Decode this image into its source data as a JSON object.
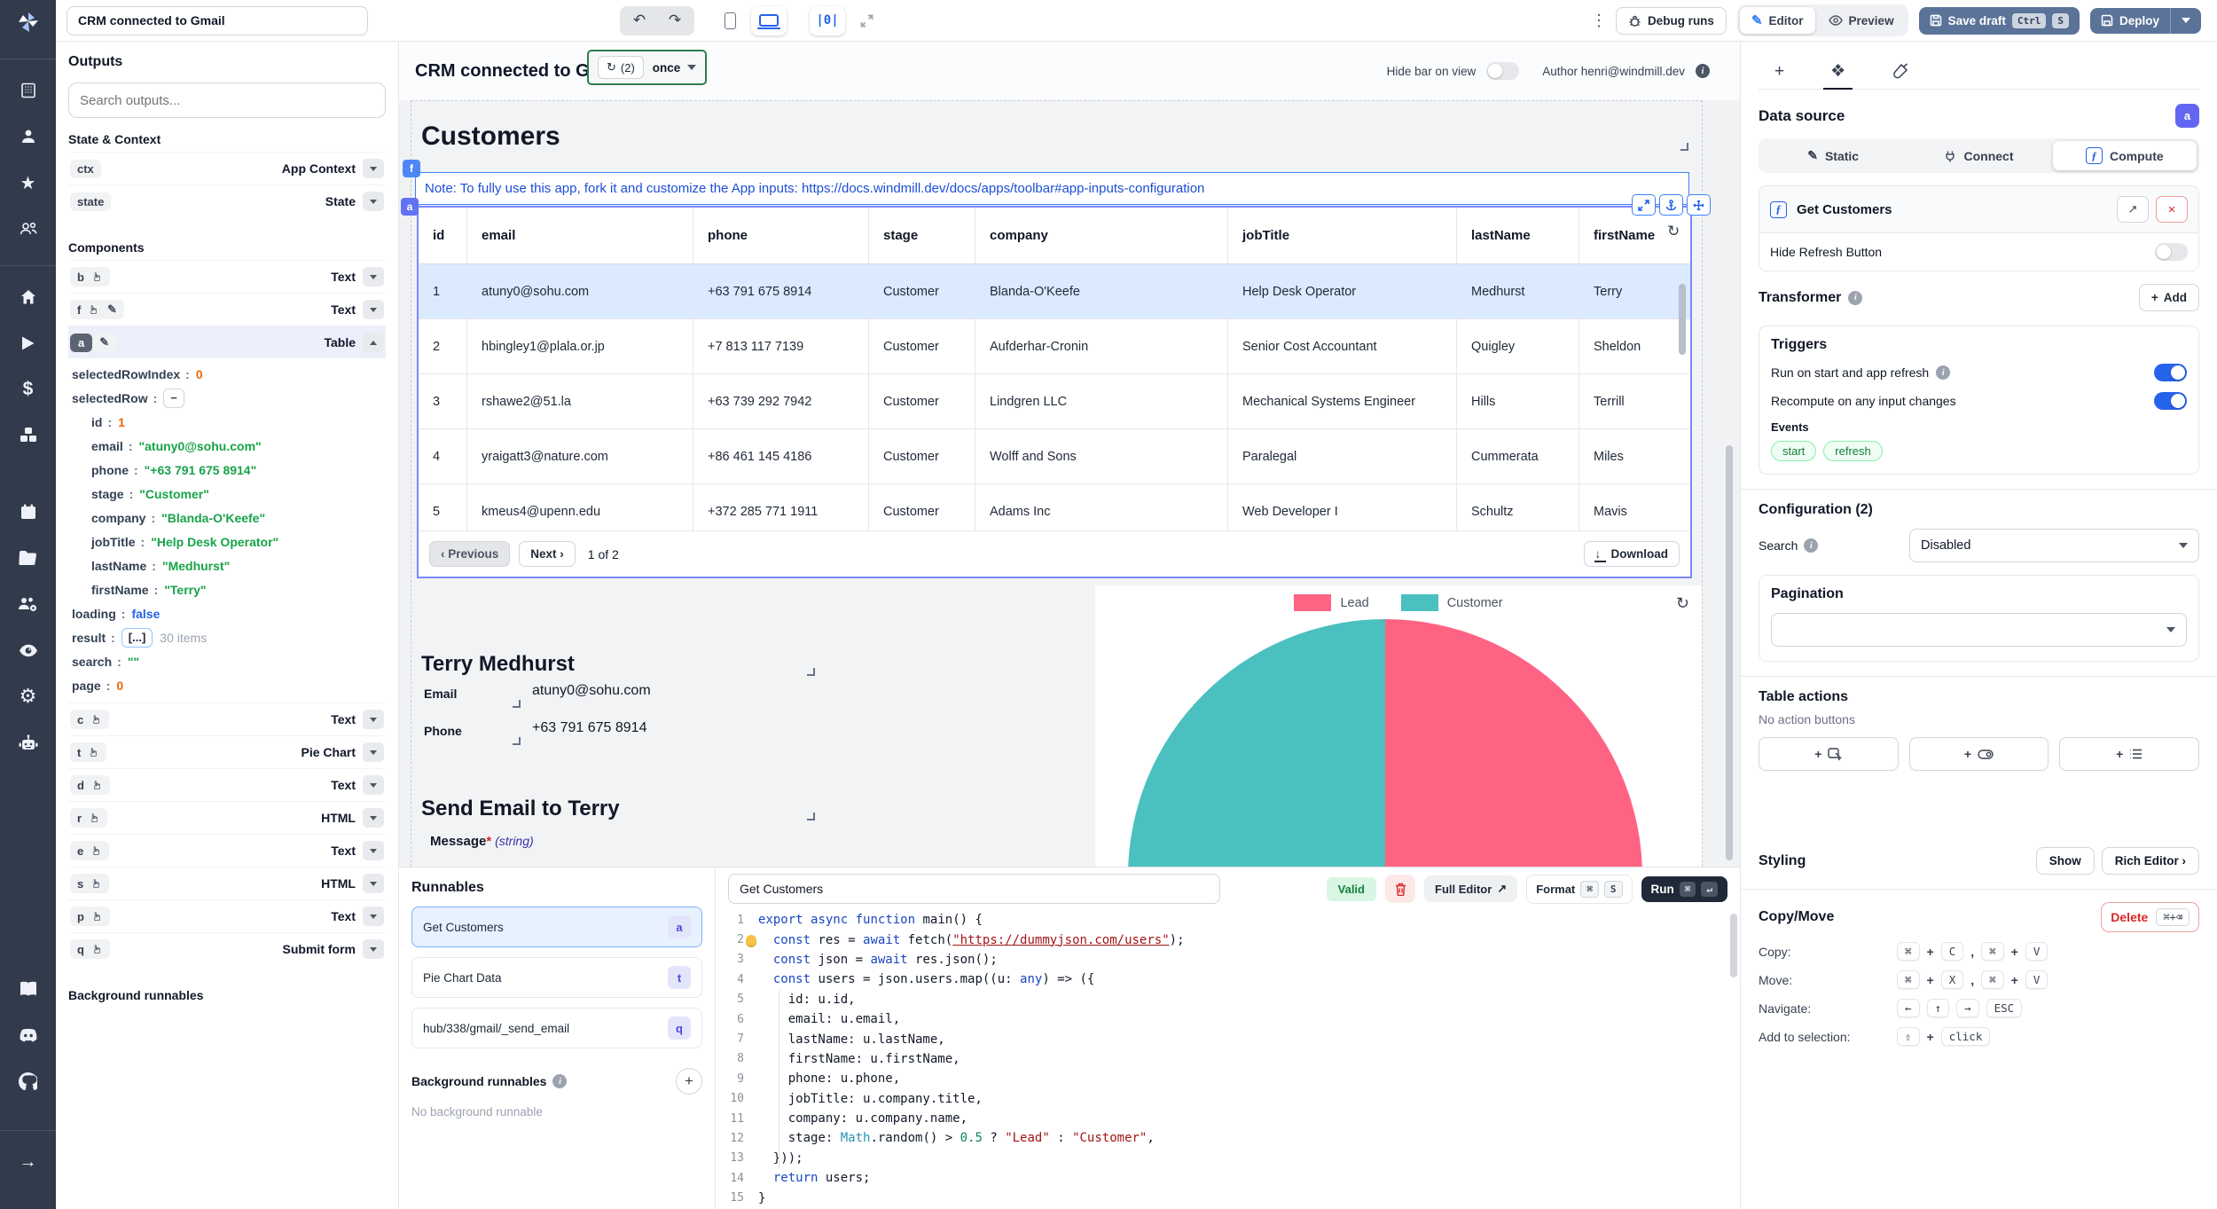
{
  "topbar": {
    "app_title_value": "CRM connected to Gmail",
    "debug_runs_label": "Debug runs",
    "editor_label": "Editor",
    "preview_label": "Preview",
    "save_draft_label": "Save draft",
    "save_kbd": [
      "Ctrl",
      "S"
    ],
    "deploy_label": "Deploy",
    "center_align_label": "|0|"
  },
  "sidebar": {
    "outputs_title": "Outputs",
    "search_placeholder": "Search outputs...",
    "state_context_title": "State & Context",
    "state_rows": [
      {
        "id": "ctx",
        "type": "App Context"
      },
      {
        "id": "state",
        "type": "State"
      }
    ],
    "components_title": "Components",
    "component_rows": [
      {
        "id": "b",
        "type": "Text",
        "icons": [
          "hand"
        ]
      },
      {
        "id": "f",
        "type": "Text",
        "icons": [
          "hand",
          "pencil"
        ]
      },
      {
        "id": "a",
        "type": "Table",
        "icons": [
          "pencil"
        ],
        "selected": true,
        "expanded": true
      },
      {
        "id": "c",
        "type": "Text",
        "icons": [
          "hand"
        ]
      },
      {
        "id": "t",
        "type": "Pie Chart",
        "icons": [
          "hand"
        ]
      },
      {
        "id": "d",
        "type": "Text",
        "icons": [
          "hand"
        ]
      },
      {
        "id": "r",
        "type": "HTML",
        "icons": [
          "hand"
        ]
      },
      {
        "id": "e",
        "type": "Text",
        "icons": [
          "hand"
        ]
      },
      {
        "id": "s",
        "type": "HTML",
        "icons": [
          "hand"
        ]
      },
      {
        "id": "p",
        "type": "Text",
        "icons": [
          "hand"
        ]
      },
      {
        "id": "q",
        "type": "Submit form",
        "icons": [
          "hand"
        ]
      }
    ],
    "table_output": [
      {
        "key": "selectedRowIndex",
        "value": "0",
        "vtype": "num",
        "indent": 0
      },
      {
        "key": "selectedRow",
        "value": "−",
        "vtype": "box",
        "indent": 0
      },
      {
        "key": "id",
        "value": "1",
        "vtype": "num",
        "indent": 1
      },
      {
        "key": "email",
        "value": "\"atuny0@sohu.com\"",
        "vtype": "str",
        "indent": 1
      },
      {
        "key": "phone",
        "value": "\"+63 791 675 8914\"",
        "vtype": "str",
        "indent": 1
      },
      {
        "key": "stage",
        "value": "\"Customer\"",
        "vtype": "str",
        "indent": 1
      },
      {
        "key": "company",
        "value": "\"Blanda-O'Keefe\"",
        "vtype": "str",
        "indent": 1
      },
      {
        "key": "jobTitle",
        "value": "\"Help Desk Operator\"",
        "vtype": "str",
        "indent": 1
      },
      {
        "key": "lastName",
        "value": "\"Medhurst\"",
        "vtype": "str",
        "indent": 1
      },
      {
        "key": "firstName",
        "value": "\"Terry\"",
        "vtype": "str",
        "indent": 1
      },
      {
        "key": "loading",
        "value": "false",
        "vtype": "bool",
        "indent": 0
      },
      {
        "key": "result",
        "value": "[...]",
        "vtype": "boxblue",
        "suffix": "30 items",
        "indent": 0
      },
      {
        "key": "search",
        "value": "\"\"",
        "vtype": "str",
        "indent": 0
      },
      {
        "key": "page",
        "value": "0",
        "vtype": "num",
        "indent": 0
      }
    ],
    "background_runnables_title": "Background runnables"
  },
  "canvas": {
    "title": "CRM connected to Gmail",
    "refresh_count": "(2)",
    "refresh_mode": "once",
    "hide_bar_label": "Hide bar on view",
    "author_label": "Author henri@windmill.dev",
    "page_title": "Customers",
    "note_badge": "f",
    "table_badge": "a",
    "note_text": "Note: To fully use this app, fork it and customize the App inputs: https://docs.windmill.dev/docs/apps/toolbar#app-inputs-configuration",
    "table": {
      "headers": [
        "id",
        "email",
        "phone",
        "stage",
        "company",
        "jobTitle",
        "lastName",
        "firstName"
      ],
      "rows": [
        [
          "1",
          "atuny0@sohu.com",
          "+63 791 675 8914",
          "Customer",
          "Blanda-O'Keefe",
          "Help Desk Operator",
          "Medhurst",
          "Terry"
        ],
        [
          "2",
          "hbingley1@plala.or.jp",
          "+7 813 117 7139",
          "Customer",
          "Aufderhar-Cronin",
          "Senior Cost Accountant",
          "Quigley",
          "Sheldon"
        ],
        [
          "3",
          "rshawe2@51.la",
          "+63 739 292 7942",
          "Customer",
          "Lindgren LLC",
          "Mechanical Systems Engineer",
          "Hills",
          "Terrill"
        ],
        [
          "4",
          "yraigatt3@nature.com",
          "+86 461 145 4186",
          "Customer",
          "Wolff and Sons",
          "Paralegal",
          "Cummerata",
          "Miles"
        ],
        [
          "5",
          "kmeus4@upenn.edu",
          "+372 285 771 1911",
          "Customer",
          "Adams Inc",
          "Web Developer I",
          "Schultz",
          "Mavis"
        ]
      ],
      "selected_row_index": 0,
      "prev_label": "Previous",
      "next_label": "Next",
      "page_indicator": "1 of 2",
      "download_label": "Download"
    },
    "contact": {
      "name": "Terry Medhurst",
      "email_label": "Email",
      "email": "atuny0@sohu.com",
      "phone_label": "Phone",
      "phone": "+63 791 675 8914"
    },
    "send_email_title": "Send Email to Terry",
    "message_label": "Message",
    "message_required": "*",
    "message_type": "(string)"
  },
  "chart_data": {
    "type": "pie",
    "labels": [
      "Lead",
      "Customer"
    ],
    "values": [
      15,
      15
    ],
    "colors": [
      "#FF6384",
      "#4BC0C0"
    ],
    "title": "",
    "legend_position": "top"
  },
  "runnables": {
    "title": "Runnables",
    "items": [
      {
        "label": "Get Customers",
        "badge": "a",
        "selected": true
      },
      {
        "label": "Pie Chart Data",
        "badge": "t",
        "selected": false
      },
      {
        "label": "hub/338/gmail/_send_email",
        "badge": "q",
        "selected": false
      }
    ],
    "background_title": "Background runnables",
    "background_empty": "No background runnable"
  },
  "editor": {
    "name_value": "Get Customers",
    "valid_label": "Valid",
    "full_editor_label": "Full Editor",
    "full_editor_icon": "↗",
    "format_label": "Format",
    "format_kbd": [
      "⌘",
      "S"
    ],
    "run_label": "Run",
    "run_kbd": [
      "⌘",
      "↵"
    ],
    "code": [
      {
        "n": "1",
        "seg": [
          [
            "k",
            "export"
          ],
          [
            "p",
            " "
          ],
          [
            "k",
            "async"
          ],
          [
            "p",
            " "
          ],
          [
            "k",
            "function"
          ],
          [
            "p",
            " main() {"
          ]
        ]
      },
      {
        "n": "2",
        "bulb": true,
        "seg": [
          [
            "p",
            "  "
          ],
          [
            "k",
            "const"
          ],
          [
            "p",
            " res = "
          ],
          [
            "k",
            "await"
          ],
          [
            "p",
            " fetch("
          ],
          [
            "sl",
            "\"https://dummyjson.com/users\""
          ],
          [
            "p",
            ");"
          ]
        ]
      },
      {
        "n": "3",
        "seg": [
          [
            "p",
            "  "
          ],
          [
            "k",
            "const"
          ],
          [
            "p",
            " json = "
          ],
          [
            "k",
            "await"
          ],
          [
            "p",
            " res.json();"
          ]
        ]
      },
      {
        "n": "4",
        "seg": [
          [
            "p",
            "  "
          ],
          [
            "k",
            "const"
          ],
          [
            "p",
            " users = json.users.map((u: "
          ],
          [
            "k",
            "any"
          ],
          [
            "p",
            ") => ({"
          ]
        ]
      },
      {
        "n": "5",
        "seg": [
          [
            "p",
            "    id: u.id,"
          ]
        ]
      },
      {
        "n": "6",
        "seg": [
          [
            "p",
            "    email: u.email,"
          ]
        ]
      },
      {
        "n": "7",
        "seg": [
          [
            "p",
            "    lastName: u.lastName,"
          ]
        ]
      },
      {
        "n": "8",
        "seg": [
          [
            "p",
            "    firstName: u.firstName,"
          ]
        ]
      },
      {
        "n": "9",
        "seg": [
          [
            "p",
            "    phone: u.phone,"
          ]
        ]
      },
      {
        "n": "10",
        "seg": [
          [
            "p",
            "    jobTitle: u.company.title,"
          ]
        ]
      },
      {
        "n": "11",
        "seg": [
          [
            "p",
            "    company: u.company.name,"
          ]
        ]
      },
      {
        "n": "12",
        "seg": [
          [
            "p",
            "    stage: "
          ],
          [
            "t",
            "Math"
          ],
          [
            "p",
            ".random() > "
          ],
          [
            "num",
            "0.5"
          ],
          [
            "p",
            " ? "
          ],
          [
            "s",
            "\"Lead\""
          ],
          [
            "p",
            " : "
          ],
          [
            "s",
            "\"Customer\""
          ],
          [
            "p",
            ","
          ]
        ]
      },
      {
        "n": "13",
        "seg": [
          [
            "p",
            "  }));"
          ]
        ]
      },
      {
        "n": "14",
        "seg": [
          [
            "p",
            "  "
          ],
          [
            "k",
            "return"
          ],
          [
            "p",
            " users;"
          ]
        ]
      },
      {
        "n": "15",
        "seg": [
          [
            "p",
            "}"
          ]
        ]
      }
    ]
  },
  "right_panel": {
    "data_source_title": "Data source",
    "component_badge": "a",
    "source_tabs": [
      {
        "label": "Static",
        "icon": "pencil",
        "active": false
      },
      {
        "label": "Connect",
        "icon": "plug",
        "active": false
      },
      {
        "label": "Compute",
        "icon": "function",
        "active": true
      }
    ],
    "runnable_name": "Get Customers",
    "hide_refresh_label": "Hide Refresh Button",
    "transformer_title": "Transformer",
    "add_label": "Add",
    "triggers_title": "Triggers",
    "trigger_rows": [
      {
        "label": "Run on start and app refresh",
        "info": true,
        "on": true
      },
      {
        "label": "Recompute on any input changes",
        "info": false,
        "on": true
      }
    ],
    "events_label": "Events",
    "event_pills": [
      "start",
      "refresh"
    ],
    "configuration_title": "Configuration (2)",
    "search_label": "Search",
    "search_value": "Disabled",
    "pagination_title": "Pagination",
    "table_actions_title": "Table actions",
    "table_actions_empty": "No action buttons",
    "styling_title": "Styling",
    "show_label": "Show",
    "rich_editor_label": "Rich Editor ›",
    "copymove_title": "Copy/Move",
    "delete_label": "Delete",
    "delete_kbd": "⌘+⌫",
    "shortcuts": [
      {
        "label": "Copy:",
        "keys": [
          "⌘",
          "+",
          "C",
          ",",
          "⌘",
          "+",
          "V"
        ]
      },
      {
        "label": "Move:",
        "keys": [
          "⌘",
          "+",
          "X",
          ",",
          "⌘",
          "+",
          "V"
        ]
      },
      {
        "label": "Navigate:",
        "keys": [
          "←",
          "↑",
          "→",
          "ESC"
        ]
      },
      {
        "label": "Add to selection:",
        "keys": [
          "⇧",
          "+",
          "click"
        ]
      }
    ]
  }
}
